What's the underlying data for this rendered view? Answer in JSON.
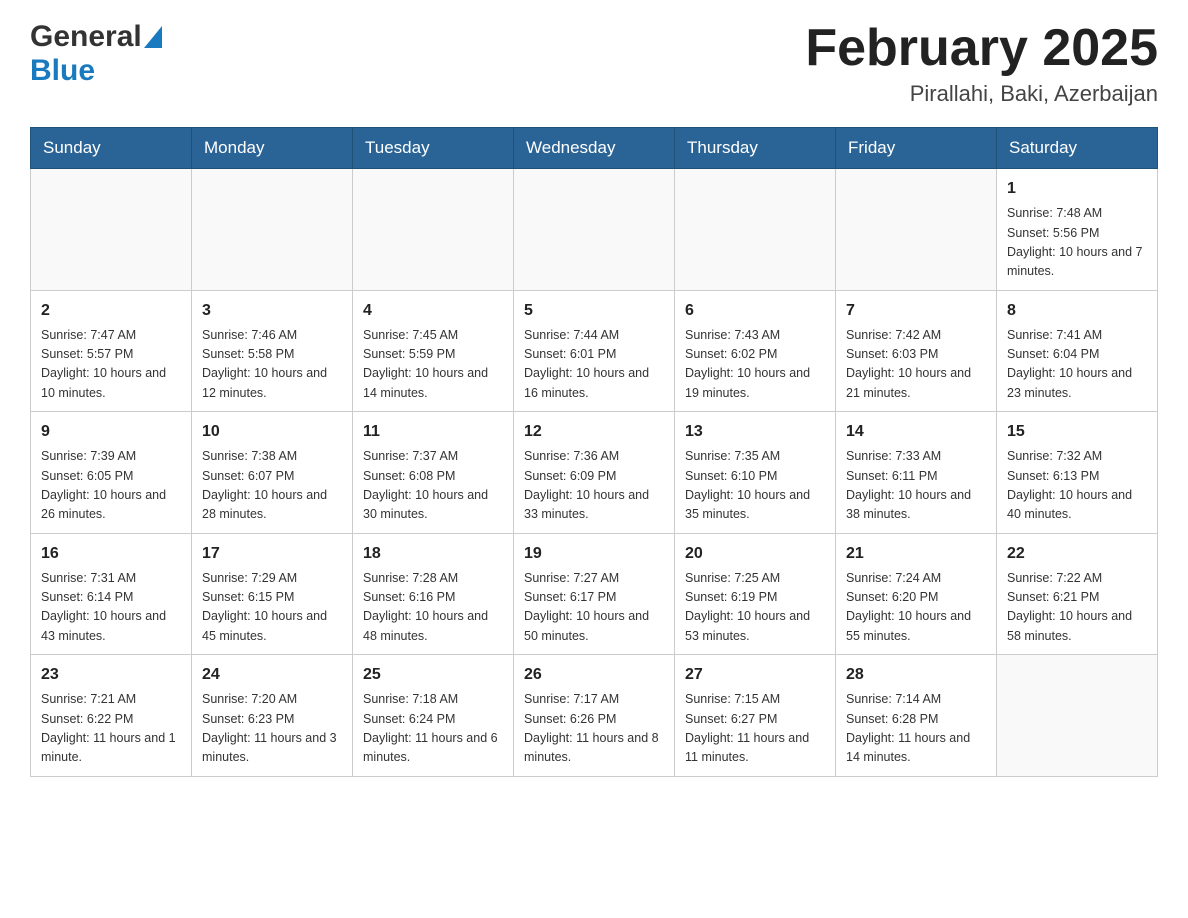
{
  "header": {
    "logo_general": "General",
    "logo_blue": "Blue",
    "month_title": "February 2025",
    "location": "Pirallahi, Baki, Azerbaijan"
  },
  "days_of_week": [
    "Sunday",
    "Monday",
    "Tuesday",
    "Wednesday",
    "Thursday",
    "Friday",
    "Saturday"
  ],
  "weeks": [
    {
      "days": [
        {
          "number": "",
          "info": ""
        },
        {
          "number": "",
          "info": ""
        },
        {
          "number": "",
          "info": ""
        },
        {
          "number": "",
          "info": ""
        },
        {
          "number": "",
          "info": ""
        },
        {
          "number": "",
          "info": ""
        },
        {
          "number": "1",
          "info": "Sunrise: 7:48 AM\nSunset: 5:56 PM\nDaylight: 10 hours and 7 minutes."
        }
      ]
    },
    {
      "days": [
        {
          "number": "2",
          "info": "Sunrise: 7:47 AM\nSunset: 5:57 PM\nDaylight: 10 hours and 10 minutes."
        },
        {
          "number": "3",
          "info": "Sunrise: 7:46 AM\nSunset: 5:58 PM\nDaylight: 10 hours and 12 minutes."
        },
        {
          "number": "4",
          "info": "Sunrise: 7:45 AM\nSunset: 5:59 PM\nDaylight: 10 hours and 14 minutes."
        },
        {
          "number": "5",
          "info": "Sunrise: 7:44 AM\nSunset: 6:01 PM\nDaylight: 10 hours and 16 minutes."
        },
        {
          "number": "6",
          "info": "Sunrise: 7:43 AM\nSunset: 6:02 PM\nDaylight: 10 hours and 19 minutes."
        },
        {
          "number": "7",
          "info": "Sunrise: 7:42 AM\nSunset: 6:03 PM\nDaylight: 10 hours and 21 minutes."
        },
        {
          "number": "8",
          "info": "Sunrise: 7:41 AM\nSunset: 6:04 PM\nDaylight: 10 hours and 23 minutes."
        }
      ]
    },
    {
      "days": [
        {
          "number": "9",
          "info": "Sunrise: 7:39 AM\nSunset: 6:05 PM\nDaylight: 10 hours and 26 minutes."
        },
        {
          "number": "10",
          "info": "Sunrise: 7:38 AM\nSunset: 6:07 PM\nDaylight: 10 hours and 28 minutes."
        },
        {
          "number": "11",
          "info": "Sunrise: 7:37 AM\nSunset: 6:08 PM\nDaylight: 10 hours and 30 minutes."
        },
        {
          "number": "12",
          "info": "Sunrise: 7:36 AM\nSunset: 6:09 PM\nDaylight: 10 hours and 33 minutes."
        },
        {
          "number": "13",
          "info": "Sunrise: 7:35 AM\nSunset: 6:10 PM\nDaylight: 10 hours and 35 minutes."
        },
        {
          "number": "14",
          "info": "Sunrise: 7:33 AM\nSunset: 6:11 PM\nDaylight: 10 hours and 38 minutes."
        },
        {
          "number": "15",
          "info": "Sunrise: 7:32 AM\nSunset: 6:13 PM\nDaylight: 10 hours and 40 minutes."
        }
      ]
    },
    {
      "days": [
        {
          "number": "16",
          "info": "Sunrise: 7:31 AM\nSunset: 6:14 PM\nDaylight: 10 hours and 43 minutes."
        },
        {
          "number": "17",
          "info": "Sunrise: 7:29 AM\nSunset: 6:15 PM\nDaylight: 10 hours and 45 minutes."
        },
        {
          "number": "18",
          "info": "Sunrise: 7:28 AM\nSunset: 6:16 PM\nDaylight: 10 hours and 48 minutes."
        },
        {
          "number": "19",
          "info": "Sunrise: 7:27 AM\nSunset: 6:17 PM\nDaylight: 10 hours and 50 minutes."
        },
        {
          "number": "20",
          "info": "Sunrise: 7:25 AM\nSunset: 6:19 PM\nDaylight: 10 hours and 53 minutes."
        },
        {
          "number": "21",
          "info": "Sunrise: 7:24 AM\nSunset: 6:20 PM\nDaylight: 10 hours and 55 minutes."
        },
        {
          "number": "22",
          "info": "Sunrise: 7:22 AM\nSunset: 6:21 PM\nDaylight: 10 hours and 58 minutes."
        }
      ]
    },
    {
      "days": [
        {
          "number": "23",
          "info": "Sunrise: 7:21 AM\nSunset: 6:22 PM\nDaylight: 11 hours and 1 minute."
        },
        {
          "number": "24",
          "info": "Sunrise: 7:20 AM\nSunset: 6:23 PM\nDaylight: 11 hours and 3 minutes."
        },
        {
          "number": "25",
          "info": "Sunrise: 7:18 AM\nSunset: 6:24 PM\nDaylight: 11 hours and 6 minutes."
        },
        {
          "number": "26",
          "info": "Sunrise: 7:17 AM\nSunset: 6:26 PM\nDaylight: 11 hours and 8 minutes."
        },
        {
          "number": "27",
          "info": "Sunrise: 7:15 AM\nSunset: 6:27 PM\nDaylight: 11 hours and 11 minutes."
        },
        {
          "number": "28",
          "info": "Sunrise: 7:14 AM\nSunset: 6:28 PM\nDaylight: 11 hours and 14 minutes."
        },
        {
          "number": "",
          "info": ""
        }
      ]
    }
  ]
}
